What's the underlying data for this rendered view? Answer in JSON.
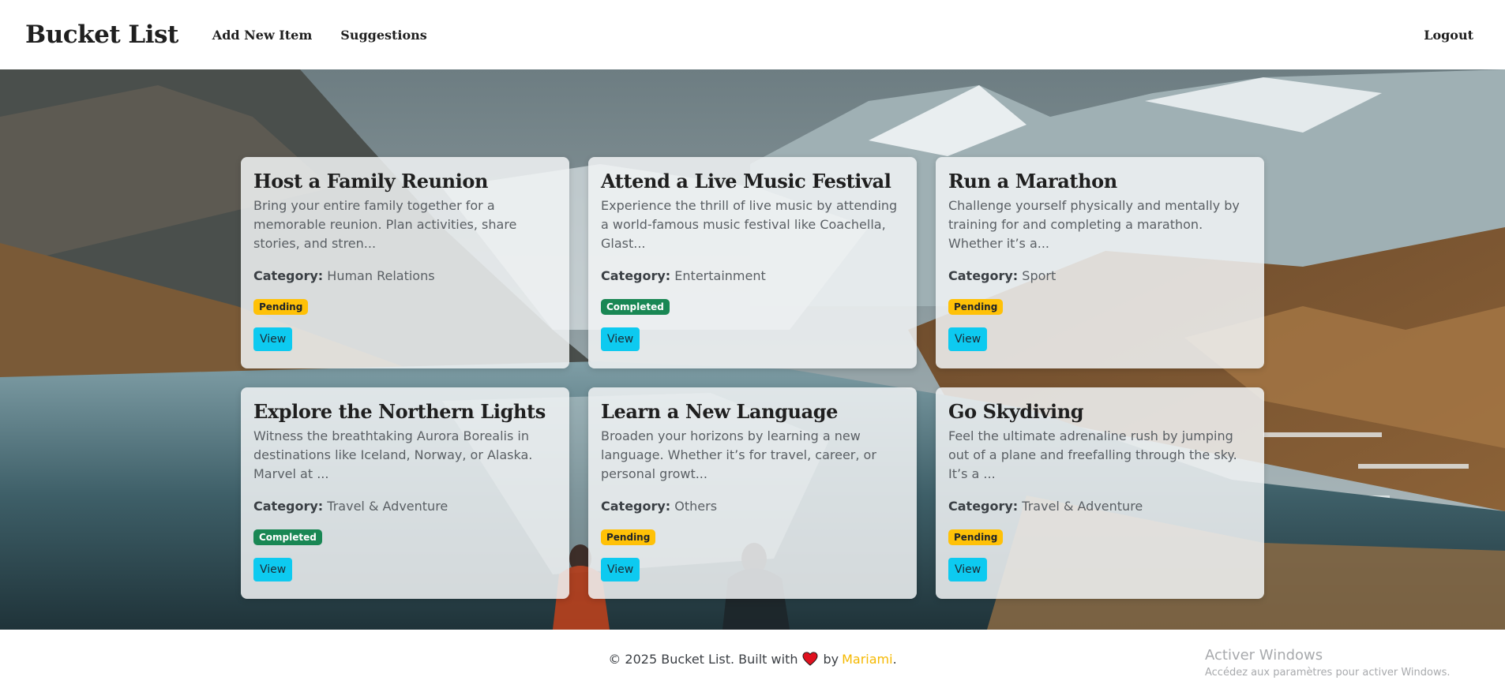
{
  "navbar": {
    "brand": "Bucket List",
    "links": [
      "Add New Item",
      "Suggestions"
    ],
    "logout": "Logout"
  },
  "cards": [
    {
      "title": "Host a Family Reunion",
      "description": "Bring your entire family together for a memorable reunion. Plan activities, share stories, and stren...",
      "category_label": "Category:",
      "category": "Human Relations",
      "status": "Pending",
      "button": "View"
    },
    {
      "title": "Attend a Live Music Festival",
      "description": "Experience the thrill of live music by attending a world-famous music festival like Coachella, Glast...",
      "category_label": "Category:",
      "category": "Entertainment",
      "status": "Completed",
      "button": "View"
    },
    {
      "title": "Run a Marathon",
      "description": "Challenge yourself physically and mentally by training for and completing a marathon. Whether it’s a...",
      "category_label": "Category:",
      "category": "Sport",
      "status": "Pending",
      "button": "View"
    },
    {
      "title": "Explore the Northern Lights",
      "description": "Witness the breathtaking Aurora Borealis in destinations like Iceland, Norway, or Alaska. Marvel at ...",
      "category_label": "Category:",
      "category": "Travel & Adventure",
      "status": "Completed",
      "button": "View"
    },
    {
      "title": "Learn a New Language",
      "description": "Broaden your horizons by learning a new language. Whether it’s for travel, career, or personal growt...",
      "category_label": "Category:",
      "category": "Others",
      "status": "Pending",
      "button": "View"
    },
    {
      "title": "Go Skydiving",
      "description": "Feel the ultimate adrenaline rush by jumping out of a plane and freefalling through the sky. It’s a ...",
      "category_label": "Category:",
      "category": "Travel & Adventure",
      "status": "Pending",
      "button": "View"
    }
  ],
  "footer": {
    "prefix": "© 2025 Bucket List. Built with",
    "by": "by",
    "author": "Mariami",
    "suffix": ".",
    "heart_icon": "heart-icon"
  },
  "watermark": {
    "line1": "Activer Windows",
    "line2": "Accédez aux paramètres pour activer Windows."
  },
  "colors": {
    "pending": "#ffc107",
    "completed": "#198754",
    "view_button": "#0dcaf0",
    "author": "#f5b800",
    "heart": "#e0111f"
  }
}
